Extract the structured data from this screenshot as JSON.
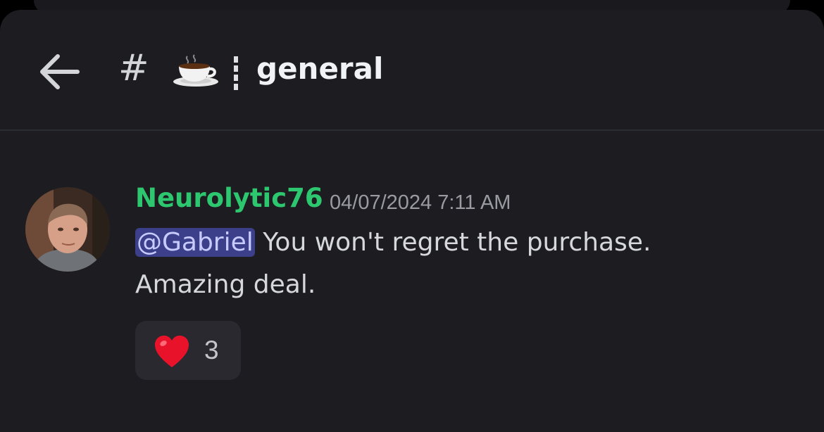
{
  "header": {
    "hash_symbol": "#",
    "cup_icon": "coffee-cup-emoji",
    "separator_icon": "dashed-vertical-bar",
    "channel_name": "general",
    "back_icon": "arrow-left-icon"
  },
  "message": {
    "username": "Neurolytic76",
    "timestamp": "04/07/2024 7:11 AM",
    "mention": "@Gabriel",
    "text_line1": " You won't regret the purchase.",
    "text_line2": "Amazing deal.",
    "reaction": {
      "emoji": "red-heart-emoji",
      "count": "3"
    }
  },
  "colors": {
    "background": "#1d1d21",
    "username": "#2dc770",
    "mention_bg": "#3c3f8a",
    "mention_text": "#c8cbff",
    "text": "#d7d8dc",
    "timestamp": "#9a9ba2"
  }
}
